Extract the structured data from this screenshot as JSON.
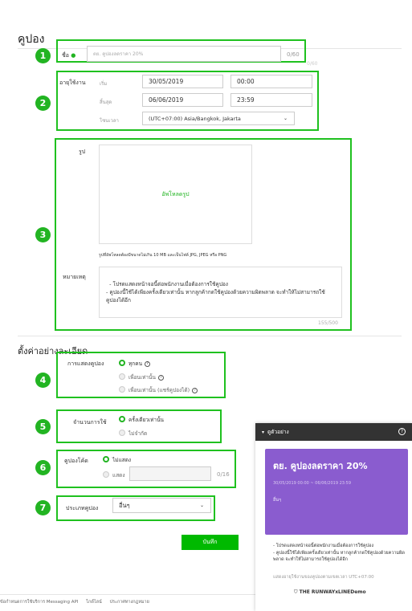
{
  "page": {
    "title": "คูปอง",
    "section_title": "ตั้งค่าอย่างละเอียด"
  },
  "badges": [
    "1",
    "2",
    "3",
    "4",
    "5",
    "6",
    "7"
  ],
  "name_field": {
    "label": "ชื่อ",
    "placeholder": "ตย. คูปองลดราคา 20%",
    "counter": "0/60",
    "counter_bg": "0/60"
  },
  "period": {
    "label": "อายุใช้งาน",
    "start_label": "เริ่ม",
    "start_date": "30/05/2019",
    "start_time": "00:00",
    "end_label": "สิ้นสุด",
    "end_date": "06/06/2019",
    "end_time": "23:59",
    "tz_label": "โซนเวลา",
    "timezone": "(UTC+07:00) Asia/Bangkok, Jakarta"
  },
  "image": {
    "label": "รูป",
    "upload_text": "อัพโหลดรูป",
    "note": "รูปที่อัพโหลดต้องมีขนาดไม่เกิน 10 MB และเป็นไฟล์ JPG, JPEG หรือ PNG"
  },
  "remarks": {
    "label": "หมายเหตุ",
    "text": "- โปรดแสดงหน้าจอนี้ต่อพนักงานเมื่อต้องการใช้คูปอง\n- คูปองนี้ใช้ได้เพียงครั้งเดียวเท่านั้น หากลูกค้ากดใช้คูปองด้วยความผิดพลาด จะทำให้ไม่สามารถใช้คูปองได้อีก",
    "counter": "155/500"
  },
  "display": {
    "label": "การแสดงคูปอง",
    "options": [
      "ทุกคน",
      "เพื่อนเท่านั้น",
      "เพื่อนเท่านั้น (แชร์คูปองได้)"
    ]
  },
  "usage": {
    "label": "จำนวนการใช้",
    "options": [
      "ครั้งเดียวเท่านั้น",
      "ไม่จำกัด"
    ]
  },
  "coupon_code": {
    "label": "คูปองโค้ด",
    "options": [
      "ไม่แสดง",
      "แสดง"
    ],
    "counter": "0/16"
  },
  "coupon_type": {
    "label": "ประเภทคูปอง",
    "value": "อื่นๆ"
  },
  "save_button": "บันทึก",
  "footer": {
    "links": [
      "ข้อกำหนดการใช้บริการ Messaging API",
      "ไกด์ไลน์",
      "ประกาศทางกฎหมาย"
    ]
  },
  "preview": {
    "header": "ดูตัวอย่าง",
    "coupon_title": "ตย. คูปองลดราคา 20%",
    "dates": "30/05/2019 00:00 ~ 06/06/2019 23:59",
    "type": "อื่นๆ",
    "remarks": "- โปรดแสดงหน้าจอนี้ต่อพนักงานเมื่อต้องการใช้คูปอง\n- คูปองนี้ใช้ได้เพียงครั้งเดียวเท่านั้น หากลูกค้ากดใช้คูปองด้วยความผิดพลาด จะทำให้ไม่สามารถใช้คูปองได้อีก",
    "validity_note": "แสดงอายุใช้งานของคูปองตามเขตเวลา UTC+07:00",
    "account": "THE RUNWAYxLINEDemo"
  },
  "colors": {
    "highlight": "#1fc11f",
    "badge": "#22b422",
    "preview_card": "#8a5ccf",
    "save": "#00b900"
  }
}
